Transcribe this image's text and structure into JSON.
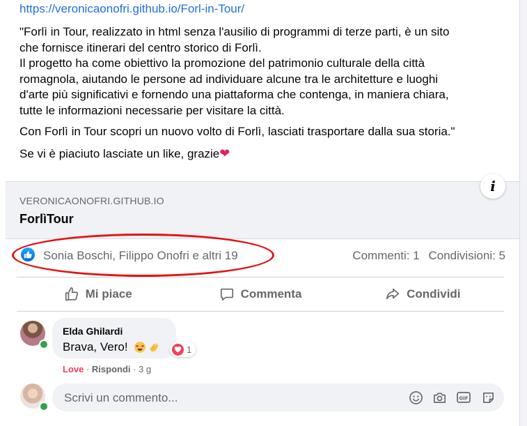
{
  "post": {
    "link": "https://veronicaonofri.github.io/Forl-in-Tour/",
    "paragraph1_line1": "\"Forlì in Tour, realizzato in html senza l'ausilio di programmi di terze parti, è un sito",
    "paragraph1_line2": "che fornisce itinerari del centro storico di Forlì.",
    "paragraph1_line3": "Il progetto ha come obiettivo la promozione del patrimonio culturale della città",
    "paragraph1_line4": "romagnola, aiutando le persone ad individuare alcune tra le architetture e luoghi",
    "paragraph1_line5": "d'arte più significativi e fornendo una piattaforma che contenga, in maniera chiara,",
    "paragraph1_line6": "tutte le informazioni necessarie per visitare la città.",
    "paragraph2": "Con Forlì in Tour scopri un nuovo volto di Forlì, lasciati trasportare dalla sua storia.\"",
    "paragraph3": "Se vi è piaciuto lasciate un like, grazie",
    "paragraph3_emoji": "❤"
  },
  "preview": {
    "domain": "VERONICAONOFRI.GITHUB.IO",
    "title": "ForlìTour",
    "info_icon": "info-icon"
  },
  "reactions": {
    "icon": "like-reaction-icon",
    "people": "Sonia Boschi, Filippo Onofri e altri 19",
    "comments": "Commenti: 1",
    "shares": "Condivisioni: 5",
    "highlight_color": "#e11313"
  },
  "actions": {
    "like": "Mi piace",
    "comment": "Commenta",
    "share": "Condividi"
  },
  "comment": {
    "author": "Elda Ghilardi",
    "text": "Brava, Vero!",
    "reaction_count": "1",
    "reaction_label": "Love",
    "separator1": " · ",
    "reply": "Rispondi",
    "separator2": " · ",
    "time": "3 g"
  },
  "composer": {
    "placeholder": "Scrivi un commento...",
    "tools": [
      "emoji-icon",
      "camera-icon",
      "gif-icon",
      "sticker-icon"
    ]
  },
  "colors": {
    "link": "#216fdb",
    "secondary_text": "#65676b",
    "love": "#f33e58",
    "online": "#31a24c"
  }
}
